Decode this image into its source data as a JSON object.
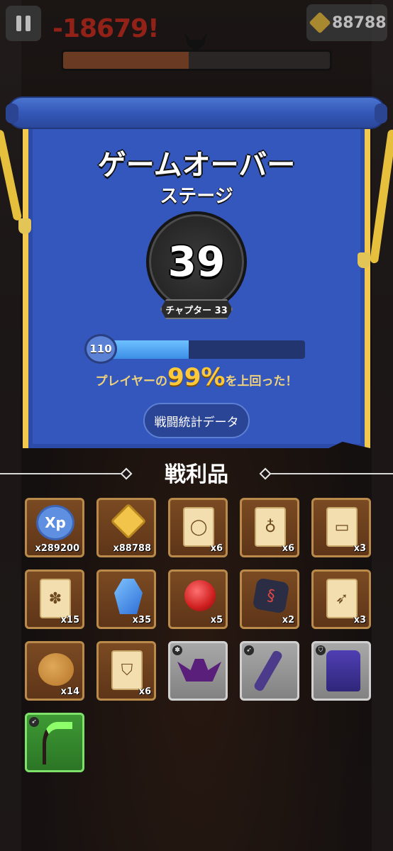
{
  "hud": {
    "damage": "-18679!",
    "boss_health": 0.47,
    "gems": "88788"
  },
  "panel": {
    "title": "ゲームオーバー",
    "stage_label": "ステージ",
    "stage_number": "39",
    "chapter": "チャプター 33",
    "player_level": "110",
    "xp_progress": 0.42,
    "surpass_prefix": "プレイヤーの",
    "surpass_percent": "99%",
    "surpass_suffix": "を上回った！",
    "stats_button": "戦闘統計データ"
  },
  "loot": {
    "title": "戦利品",
    "items": [
      {
        "name": "xp",
        "icon": "xp-orb-icon",
        "qty": "x289200"
      },
      {
        "name": "gems",
        "icon": "gold-gem-icon",
        "qty": "x88788"
      },
      {
        "name": "ring-scroll",
        "icon": "ring-scroll-icon",
        "qty": "x6"
      },
      {
        "name": "amulet-scroll",
        "icon": "amulet-scroll-icon",
        "qty": "x6"
      },
      {
        "name": "bracelet-scroll",
        "icon": "bracelet-scroll-icon",
        "qty": "x3"
      },
      {
        "name": "pet-scroll",
        "icon": "paw-scroll-icon",
        "qty": "x15"
      },
      {
        "name": "sapphire",
        "icon": "blue-gem-icon",
        "qty": "x35"
      },
      {
        "name": "ruby",
        "icon": "red-gem-icon",
        "qty": "x5"
      },
      {
        "name": "dark-stone",
        "icon": "dark-stone-icon",
        "qty": "x2"
      },
      {
        "name": "bow-scroll",
        "icon": "bow-scroll-icon",
        "qty": "x3"
      },
      {
        "name": "cookie",
        "icon": "cookie-icon",
        "qty": "x14"
      },
      {
        "name": "armor-scroll",
        "icon": "armor-scroll-icon",
        "qty": "x6"
      },
      {
        "name": "bat-pet",
        "icon": "bat-icon",
        "qty": ""
      },
      {
        "name": "katana",
        "icon": "katana-icon",
        "qty": ""
      },
      {
        "name": "vest",
        "icon": "vest-icon",
        "qty": ""
      },
      {
        "name": "scythe",
        "icon": "scythe-icon",
        "qty": ""
      }
    ]
  }
}
